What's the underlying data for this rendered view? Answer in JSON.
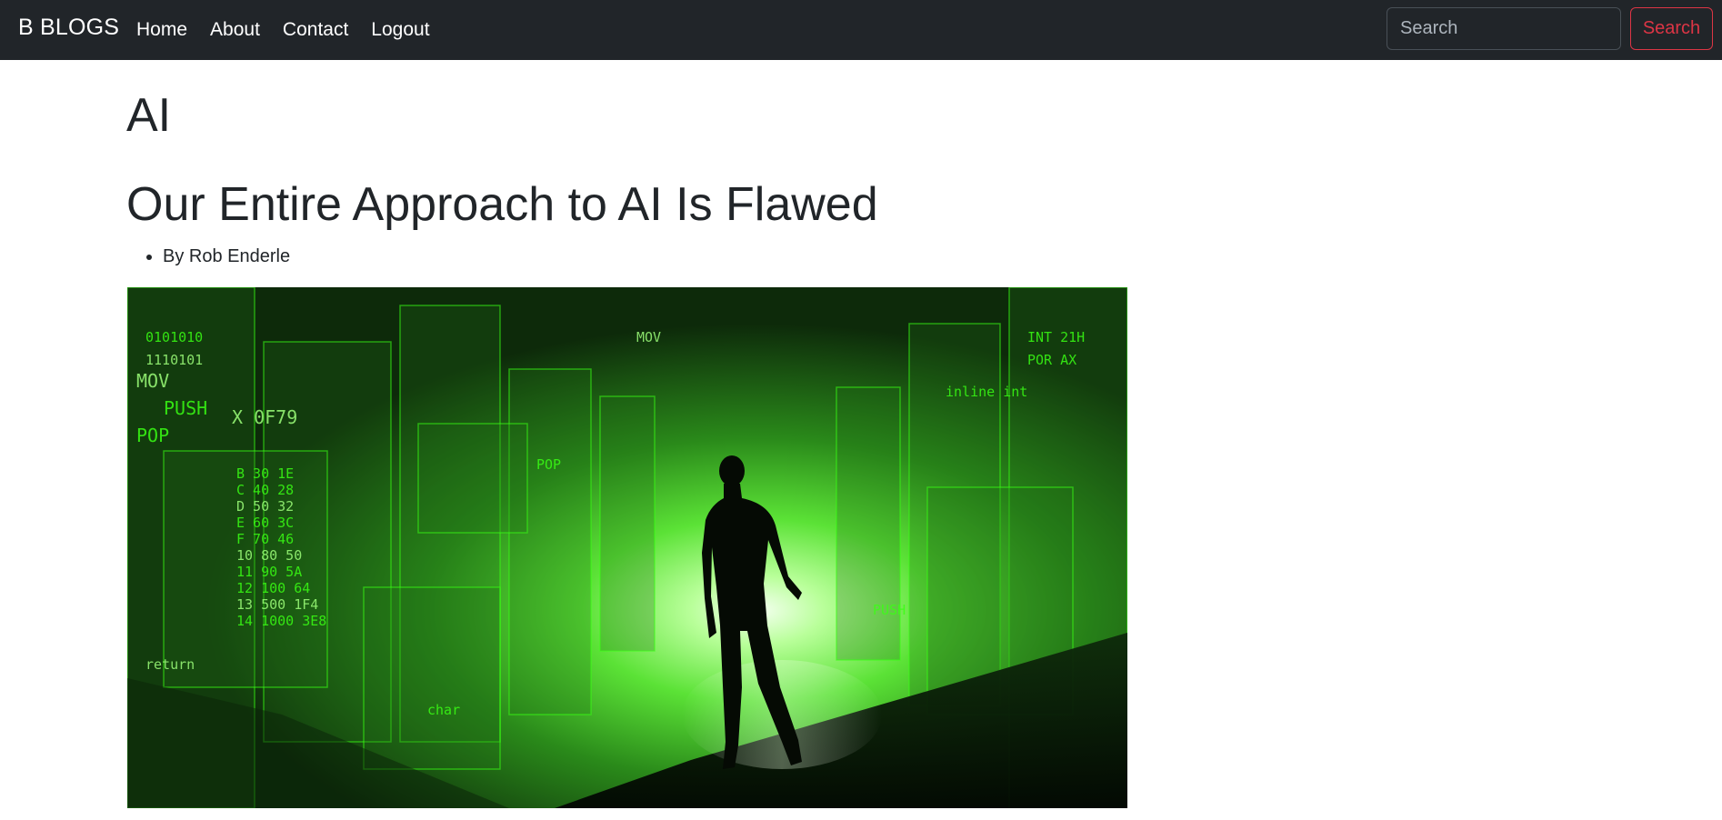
{
  "navbar": {
    "brand": "B BLOGS",
    "links": [
      "Home",
      "About",
      "Contact",
      "Logout"
    ],
    "search": {
      "placeholder": "Search",
      "value": "",
      "button_label": "Search"
    }
  },
  "page": {
    "category": "AI",
    "post": {
      "title": "Our Entire Approach to AI Is Flawed",
      "meta": [
        "By Rob Enderle"
      ]
    }
  },
  "hero_image": {
    "code_glyphs": [
      "MOV",
      "PUSH",
      "POP",
      "X 0F79",
      "B 30 1E",
      "C 40 28",
      "D 50 32",
      "E 60 3C",
      "F 70 46",
      "10 80 50",
      "11 90 5A",
      "12 100 64",
      "13 500 1F4",
      "14 1000 3E8",
      "0101010",
      "1110101",
      "INT 21H",
      "POR AX",
      "return",
      "inline int",
      "char"
    ]
  },
  "colors": {
    "navbar_bg": "#212529",
    "accent_danger": "#dc3545",
    "text": "#212529",
    "matrix_green": "#39ff14"
  }
}
